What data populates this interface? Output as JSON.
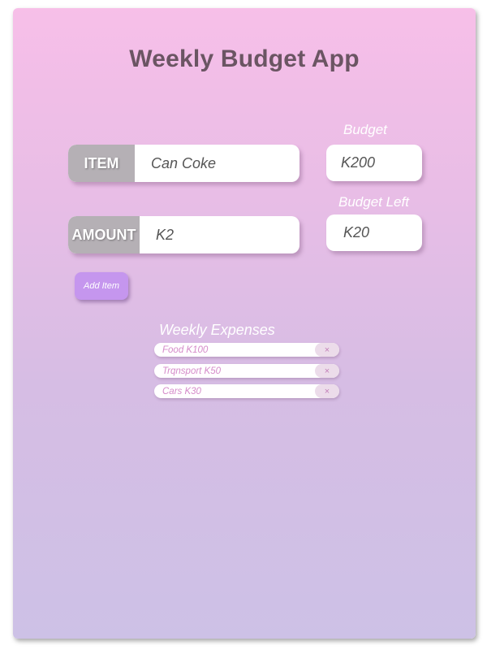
{
  "app": {
    "title": "Weekly Budget App"
  },
  "item_field": {
    "tag": "ITEM",
    "value": "Can Coke"
  },
  "amount_field": {
    "tag": "AMOUNT",
    "value": "K2"
  },
  "budget": {
    "label": "Budget",
    "value": "K200"
  },
  "budget_left": {
    "label": "Budget Left",
    "value": "K20"
  },
  "add_button": {
    "label": "Add Item"
  },
  "expenses": {
    "title": "Weekly Expenses",
    "items": [
      {
        "text": "Food K100",
        "remove_label": "×"
      },
      {
        "text": "Trqnsport K50",
        "remove_label": "×"
      },
      {
        "text": "Cars K30",
        "remove_label": "×"
      }
    ]
  },
  "colors": {
    "gradient_top": "#f7bfe8",
    "gradient_bottom": "#cdc1e6",
    "title": "#6b5563",
    "tag_bg": "#b5b0b5",
    "button_bg": "#c596ee",
    "expense_text": "#d58bc9"
  }
}
